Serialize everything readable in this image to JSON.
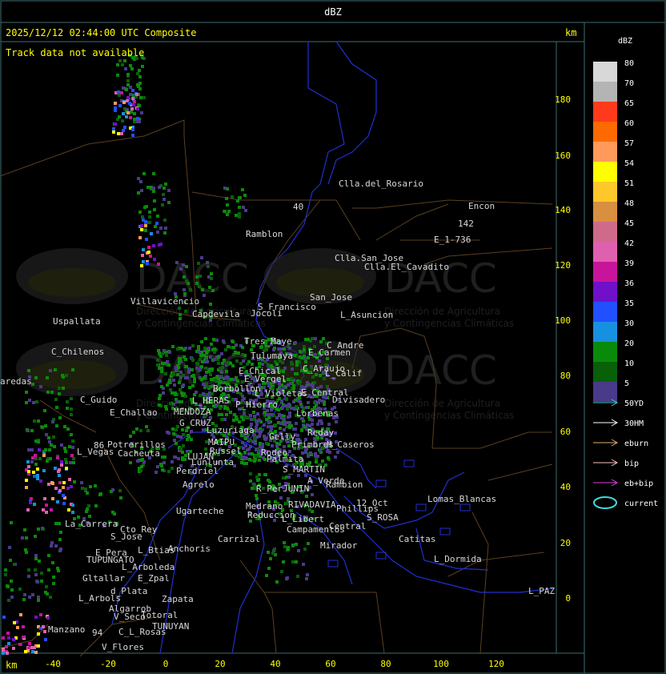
{
  "header": {
    "product_label": "dBZ",
    "timestamp": "2025/12/12 02:44:00 UTC Composite",
    "track_status": "Track data not available",
    "axis_unit_top": "km",
    "axis_unit_bottom": "km"
  },
  "axes": {
    "x_ticks": [
      "-40",
      "-20",
      "0",
      "20",
      "40",
      "60",
      "80",
      "100",
      "120"
    ],
    "y_ticks": [
      "180",
      "160",
      "140",
      "120",
      "100",
      "80",
      "60",
      "40",
      "20",
      "0"
    ]
  },
  "legend": {
    "title": "dBZ",
    "levels": [
      {
        "label": "80",
        "color": "#d8d8d8"
      },
      {
        "label": "70",
        "color": "#b4b4b4"
      },
      {
        "label": "65",
        "color": "#ff3a1a"
      },
      {
        "label": "60",
        "color": "#ff6a00"
      },
      {
        "label": "57",
        "color": "#ff9a5a"
      },
      {
        "label": "54",
        "color": "#ffff00"
      },
      {
        "label": "51",
        "color": "#ffc82a"
      },
      {
        "label": "48",
        "color": "#d89040"
      },
      {
        "label": "45",
        "color": "#d06a8a"
      },
      {
        "label": "42",
        "color": "#e060b0"
      },
      {
        "label": "39",
        "color": "#c8149a"
      },
      {
        "label": "36",
        "color": "#7010c8"
      },
      {
        "label": "35",
        "color": "#2050ff"
      },
      {
        "label": "30",
        "color": "#1890e0"
      },
      {
        "label": "20",
        "color": "#0a8a0a"
      },
      {
        "label": "10",
        "color": "#086008"
      },
      {
        "label": "5",
        "color": "#4a3a8a"
      }
    ],
    "tracks": [
      {
        "label": "50YD",
        "color": "#40d0d0"
      },
      {
        "label": "30HM",
        "color": "#ffffff"
      },
      {
        "label": "eburn",
        "color": "#e0b070"
      },
      {
        "label": "bip",
        "color": "#ffc0c0"
      },
      {
        "label": "eb+bip",
        "color": "#e040e0"
      },
      {
        "label": "current",
        "color": "#40d8e0"
      }
    ]
  },
  "watermark": {
    "brand": "DACC",
    "subtitle_1": "Dirección de Agricultura",
    "subtitle_2": "y Contingencias Climáticas"
  },
  "places": [
    {
      "name": "Clla.del_Rosario"
    },
    {
      "name": "Encon"
    },
    {
      "name": "E_1-736"
    },
    {
      "name": "142"
    },
    {
      "name": "Ramblon"
    },
    {
      "name": "Clla.San_Jose"
    },
    {
      "name": "Clla.El_Cavadito"
    },
    {
      "name": "Villavicencio"
    },
    {
      "name": "S_Francisco"
    },
    {
      "name": "San_Jose"
    },
    {
      "name": "Jocoli"
    },
    {
      "name": "L_Asuncion"
    },
    {
      "name": "Uspallata"
    },
    {
      "name": "Capdevila"
    },
    {
      "name": "Tres_Maye"
    },
    {
      "name": "C_Andre"
    },
    {
      "name": "C_Chilenos"
    },
    {
      "name": "Tulumaya"
    },
    {
      "name": "E_Carmen"
    },
    {
      "name": "E_Chical"
    },
    {
      "name": "C_Araujo"
    },
    {
      "name": "L_Calif"
    },
    {
      "name": "aredas"
    },
    {
      "name": "E_Vergel"
    },
    {
      "name": "Borbollon"
    },
    {
      "name": "L_Violetas"
    },
    {
      "name": "E_Central"
    },
    {
      "name": "C_Guido"
    },
    {
      "name": "L_HERAS"
    },
    {
      "name": "P_Hierro"
    },
    {
      "name": "Divisadero"
    },
    {
      "name": "E_Challao"
    },
    {
      "name": "MENDOZA"
    },
    {
      "name": "Lorbenas"
    },
    {
      "name": "G_CRUZ"
    },
    {
      "name": "Luzuriaga"
    },
    {
      "name": "Gelly"
    },
    {
      "name": "Reday"
    },
    {
      "name": "Potrerillos"
    },
    {
      "name": "MAIPU"
    },
    {
      "name": "Primbres"
    },
    {
      "name": "M_Caseros"
    },
    {
      "name": "L_Vegas"
    },
    {
      "name": "Cacheuta"
    },
    {
      "name": "Russel"
    },
    {
      "name": "Rodeo"
    },
    {
      "name": "LUJAN"
    },
    {
      "name": "Palmita"
    },
    {
      "name": "Lunlunta"
    },
    {
      "name": "S_MARTIN"
    },
    {
      "name": "Perdriel"
    },
    {
      "name": "A_Verde"
    },
    {
      "name": "Rambion"
    },
    {
      "name": "Agrelo"
    },
    {
      "name": "R_PerJUNIN"
    },
    {
      "name": "12_Oct"
    },
    {
      "name": "Lomas_Blancas"
    },
    {
      "name": "Medrano"
    },
    {
      "name": "RIVADAVIA"
    },
    {
      "name": "Phillips"
    },
    {
      "name": "Ugarteche"
    },
    {
      "name": "Reduccion"
    },
    {
      "name": "S_ROSA"
    },
    {
      "name": "L_Libert"
    },
    {
      "name": "Central"
    },
    {
      "name": "La_Carrera"
    },
    {
      "name": "Cto_Rey"
    },
    {
      "name": "Campamentos"
    },
    {
      "name": "Catitas"
    },
    {
      "name": "S_Jose"
    },
    {
      "name": "Carrizal"
    },
    {
      "name": "Mirador"
    },
    {
      "name": "E_Pera"
    },
    {
      "name": "Anchoris"
    },
    {
      "name": "L_Btias"
    },
    {
      "name": "TUPUNGATO"
    },
    {
      "name": "L_Dormida"
    },
    {
      "name": "L_Arboleda"
    },
    {
      "name": "Gltallar"
    },
    {
      "name": "E_Zpal"
    },
    {
      "name": "d_Plata"
    },
    {
      "name": "Zapata"
    },
    {
      "name": "L_PAZ"
    },
    {
      "name": "L_Arbols"
    },
    {
      "name": "Algarrob"
    },
    {
      "name": "Totoral"
    },
    {
      "name": "V_Seco"
    },
    {
      "name": "TUNUYAN"
    },
    {
      "name": "Manzano"
    },
    {
      "name": "C_L_Rosas"
    },
    {
      "name": "94"
    },
    {
      "name": "V_Flores"
    },
    {
      "name": "86"
    },
    {
      "name": "40"
    }
  ]
}
